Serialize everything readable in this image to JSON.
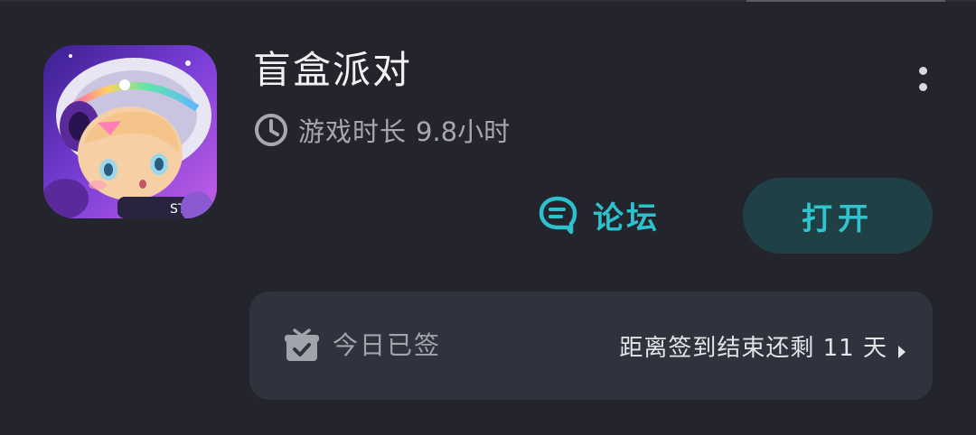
{
  "app": {
    "title": "盲盒派对",
    "icon": "anime-astronaut-app-icon"
  },
  "playtime": {
    "icon": "clock-icon",
    "label": "游戏时长",
    "value": "9.8小时"
  },
  "menu": {
    "icon": "more-vertical-icon"
  },
  "actions": {
    "forum_label": "论坛",
    "forum_icon": "chat-bubble-icon",
    "open_label": "打开"
  },
  "signin": {
    "icon": "gift-check-icon",
    "status": "今日已签",
    "remaining": "距离签到结束还剩 11 天",
    "chevron_icon": "chevron-right-icon"
  },
  "colors": {
    "background": "#23242c",
    "panel": "#30323d",
    "accent": "#2cc1cc",
    "open_button_bg": "#1f4145",
    "title_text": "#f2f2f4",
    "muted_text": "#a7a8ae"
  }
}
